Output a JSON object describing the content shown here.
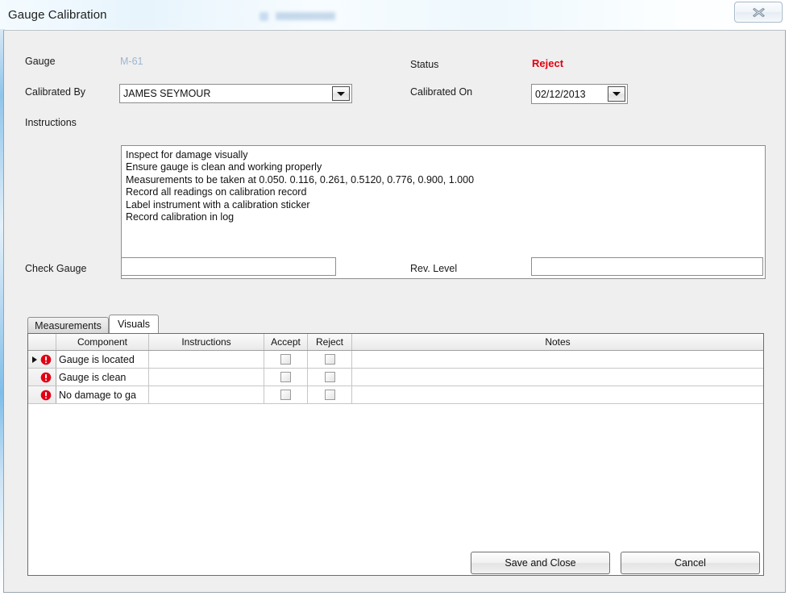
{
  "window": {
    "title": "Gauge Calibration",
    "close_label": "X"
  },
  "form": {
    "gauge_label": "Gauge",
    "gauge_value": "M-61",
    "calibrated_by_label": "Calibrated By",
    "calibrated_by_value": "JAMES SEYMOUR",
    "status_label": "Status",
    "status_value": "Reject",
    "status_color": "#e2000f",
    "calibrated_on_label": "Calibrated On",
    "calibrated_on_value": "02/12/2013",
    "instructions_label": "Instructions",
    "instructions_lines": [
      "Inspect for damage visually",
      "Ensure gauge is clean and working properly",
      "Measurements to be taken at 0.050. 0.116, 0.261, 0.5120, 0.776, 0.900, 1.000",
      "Record all readings on calibration record",
      "Label instrument with a calibration sticker",
      "Record calibration in log"
    ],
    "check_gauge_label": "Check Gauge",
    "check_gauge_value": "",
    "rev_level_label": "Rev. Level",
    "rev_level_value": ""
  },
  "tabs": [
    {
      "label": "Measurements",
      "active": false
    },
    {
      "label": "Visuals",
      "active": true
    }
  ],
  "grid": {
    "columns": [
      "Component",
      "Instructions",
      "Accept",
      "Reject",
      "Notes"
    ],
    "rows": [
      {
        "selected": true,
        "error": true,
        "component": "Gauge is located",
        "instructions": "",
        "accept": false,
        "reject": false,
        "notes": ""
      },
      {
        "selected": false,
        "error": true,
        "component": "Gauge is clean",
        "instructions": "",
        "accept": false,
        "reject": false,
        "notes": ""
      },
      {
        "selected": false,
        "error": true,
        "component": "No damage to ga",
        "instructions": "",
        "accept": false,
        "reject": false,
        "notes": ""
      }
    ]
  },
  "footer": {
    "save_label": "Save and Close",
    "cancel_label": "Cancel"
  }
}
